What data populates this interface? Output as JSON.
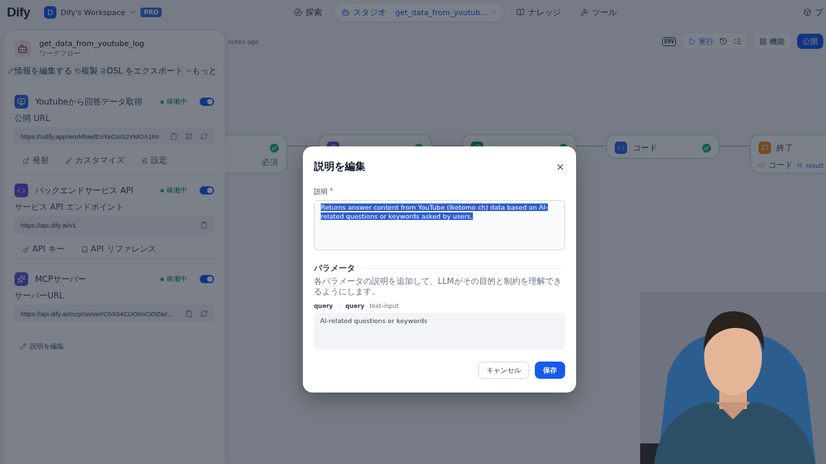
{
  "top_bar": {
    "logo": "Dify",
    "workspace": {
      "initial": "D",
      "name": "Dify's Workspace",
      "plan": "PRO"
    },
    "nav": [
      {
        "kind": "explore",
        "label": "探索",
        "selected": false
      },
      {
        "kind": "studio",
        "label": "スタジオ",
        "app_name": "get_data_from_youtub...",
        "selected": true
      },
      {
        "kind": "knowledge",
        "label": "ナレッジ",
        "selected": false
      },
      {
        "kind": "tools",
        "label": "ツール",
        "selected": false
      }
    ],
    "plugins": "プ"
  },
  "app_panel": {
    "name": "get_data_from_youtube_log",
    "type": "ワークフロー",
    "actions": [
      {
        "kind": "edit",
        "label": "情報を編集する"
      },
      {
        "kind": "copy",
        "label": "複製"
      },
      {
        "kind": "export",
        "label": "DSL をエクスポート"
      },
      {
        "kind": "more",
        "label": "もっと"
      }
    ],
    "sections": [
      {
        "kind": "webapp",
        "title": "Youtubeから回答データ取得",
        "status": "稼働中",
        "on": true,
        "url_label": "公開 URL",
        "url": "https://udify.app/workflow/EoYaGxIS2YMOA1lm",
        "links": [
          {
            "kind": "launch",
            "label": "発射"
          },
          {
            "kind": "customize",
            "label": "カスタマイズ"
          },
          {
            "kind": "settings",
            "label": "設定"
          }
        ]
      },
      {
        "kind": "api",
        "title": "バックエンドサービス API",
        "status": "稼働中",
        "on": true,
        "url_label": "サービス API エンドポイント",
        "url": "https://api.dify.ai/v1",
        "links": [
          {
            "kind": "key",
            "label": "API キー"
          },
          {
            "kind": "reference",
            "label": "API リファレンス"
          }
        ]
      },
      {
        "kind": "mcp",
        "title": "MCPサーバー",
        "status": "稼働中",
        "on": true,
        "url_label": "サーバーURL",
        "url": "https://api.dify.ai/mcp/server/ChX64CUOknCi0IZw/..."
      }
    ],
    "edit_description": "説明を編集"
  },
  "canvas": {
    "updated": "nutes ago",
    "toolbar": [
      {
        "kind": "env",
        "label": "ENV"
      },
      {
        "kind": "run",
        "label": "実行"
      },
      {
        "kind": "history"
      },
      {
        "kind": "checklist"
      },
      {
        "kind": "features",
        "label": "機能"
      },
      {
        "kind": "publish",
        "label": "公開"
      }
    ],
    "nodes": [
      {
        "kind": "start",
        "done": true,
        "note": "必須"
      },
      {
        "kind": "llm",
        "done": true
      },
      {
        "kind": "knowledge",
        "done": true
      },
      {
        "kind": "code",
        "title": "コード",
        "done": true
      },
      {
        "kind": "end",
        "title": "終了",
        "output_source": "コード",
        "output_var": "result"
      }
    ]
  },
  "modal": {
    "title": "説明を編集",
    "description": {
      "label": "説明",
      "required_mark": "*",
      "value": "Returns answer content from YouTube (Iketomo ch) data based on AI-related questions or keywords asked by users.",
      "selected": true
    },
    "parameters": {
      "heading": "パラメータ",
      "hint": "各パラメータの説明を追加して、LLMがその目的と制約を理解できるようにします。",
      "items": [
        {
          "name": "query",
          "label": "query",
          "type": "text-input",
          "value": "AI-related questions or keywords"
        }
      ]
    },
    "buttons": [
      {
        "kind": "secondary",
        "label": "キャンセル"
      },
      {
        "kind": "primary",
        "label": "保存"
      }
    ]
  }
}
